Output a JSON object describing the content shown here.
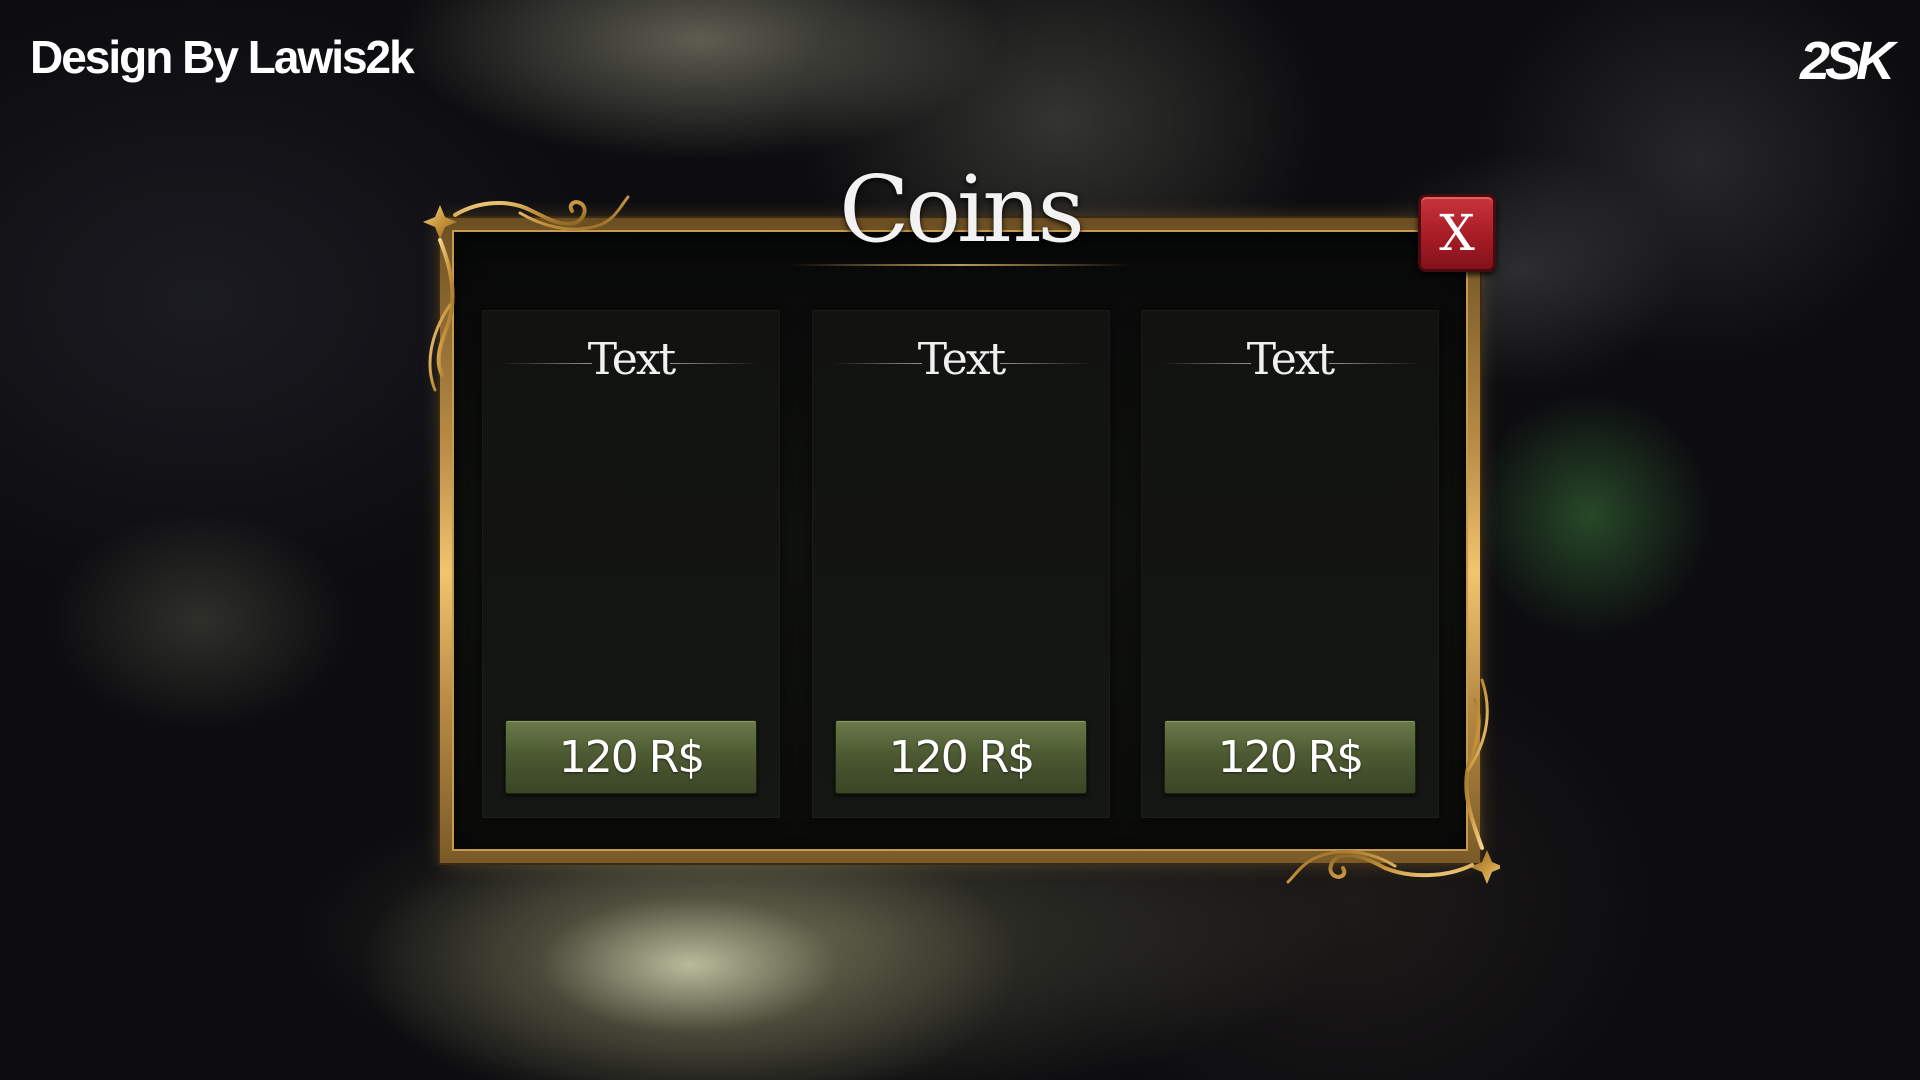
{
  "overlay": {
    "credit": "Design By Lawis2k",
    "logo": "2SK"
  },
  "dialog": {
    "title": "Coins",
    "close_label": "X",
    "cards": [
      {
        "title": "Text",
        "price": "120 R$"
      },
      {
        "title": "Text",
        "price": "120 R$"
      },
      {
        "title": "Text",
        "price": "120 R$"
      }
    ]
  },
  "colors": {
    "frame_gold": "#c79a52",
    "close_red": "#a71c25",
    "button_green": "#4d5a32"
  },
  "icons": {
    "ornament": "gold-filigree-corner-icon",
    "close": "close-icon"
  }
}
